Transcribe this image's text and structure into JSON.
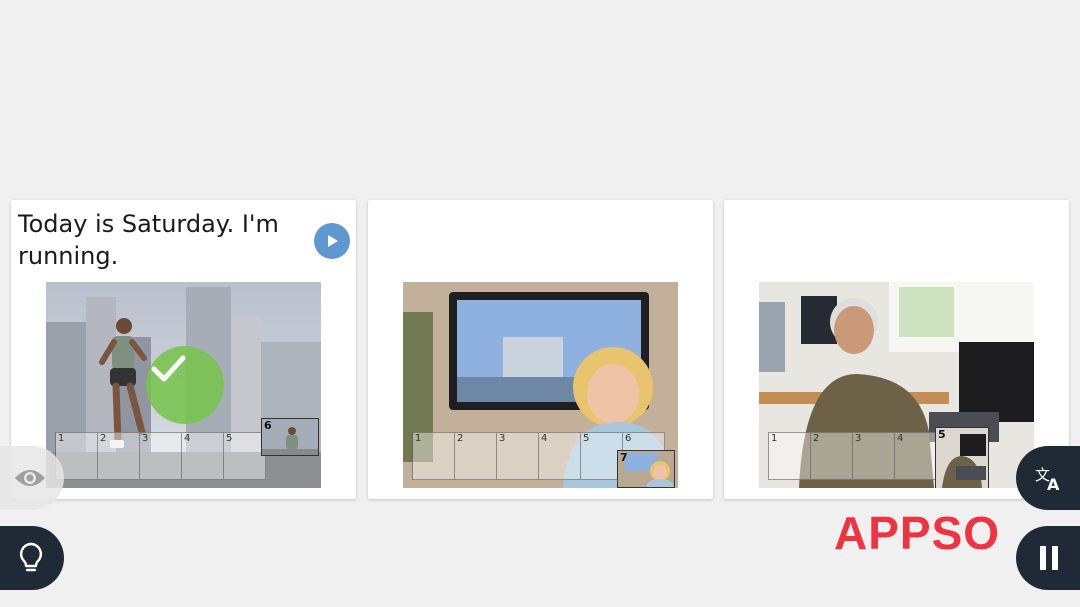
{
  "cards": [
    {
      "prompt": "Today is Saturday. I'm running.",
      "grid_cells": [
        "1",
        "2",
        "3",
        "4",
        "5"
      ],
      "thumb_label": "6",
      "answered_correct": true
    },
    {
      "prompt": "",
      "grid_cells": [
        "1",
        "2",
        "3",
        "4",
        "5",
        "6"
      ],
      "thumb_label": "7"
    },
    {
      "prompt": "",
      "grid_cells": [
        "1",
        "2",
        "3",
        "4"
      ],
      "thumb_label": "5"
    }
  ],
  "icons": {
    "play": "play-icon",
    "check": "checkmark-icon",
    "eye": "eye-icon",
    "hint": "lightbulb-icon",
    "translate": "translate-icon",
    "pause": "pause-icon"
  },
  "logo": {
    "text": "APPSO"
  },
  "colors": {
    "background": "#f0f0f0",
    "play_button": "#5f97d0",
    "check": "#76c44c",
    "dark_button": "#1f2a36",
    "logo": "#ef3340"
  }
}
